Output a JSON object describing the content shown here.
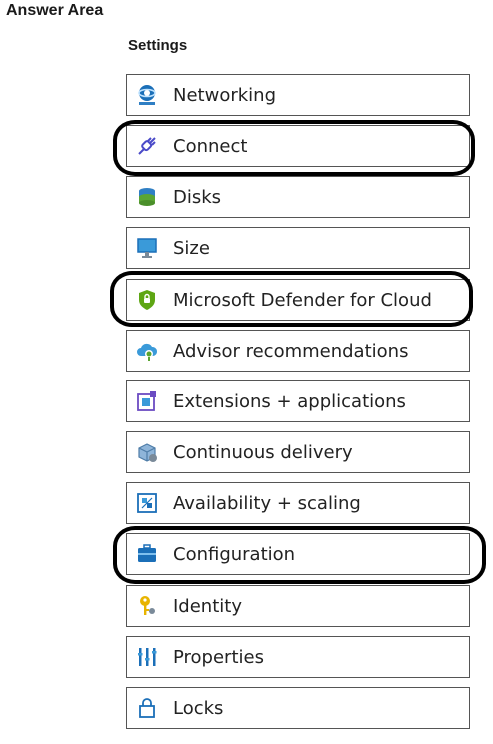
{
  "answer_area": {
    "title": "Answer Area"
  },
  "settings": {
    "title": "Settings",
    "items": [
      {
        "label": "Networking",
        "icon": "networking-icon",
        "selected": false
      },
      {
        "label": "Connect",
        "icon": "connect-icon",
        "selected": true
      },
      {
        "label": "Disks",
        "icon": "disks-icon",
        "selected": false
      },
      {
        "label": "Size",
        "icon": "size-icon",
        "selected": false
      },
      {
        "label": "Microsoft Defender for Cloud",
        "icon": "defender-shield-icon",
        "selected": true
      },
      {
        "label": "Advisor recommendations",
        "icon": "advisor-cloud-icon",
        "selected": false
      },
      {
        "label": "Extensions + applications",
        "icon": "extensions-icon",
        "selected": false
      },
      {
        "label": "Continuous delivery",
        "icon": "continuous-delivery-icon",
        "selected": false
      },
      {
        "label": "Availability + scaling",
        "icon": "availability-scaling-icon",
        "selected": false
      },
      {
        "label": "Configuration",
        "icon": "configuration-icon",
        "selected": true
      },
      {
        "label": "Identity",
        "icon": "identity-key-icon",
        "selected": false
      },
      {
        "label": "Properties",
        "icon": "properties-icon",
        "selected": false
      },
      {
        "label": "Locks",
        "icon": "lock-icon",
        "selected": false
      }
    ]
  },
  "colors": {
    "highlight_ring": "#000000",
    "item_border": "#555555",
    "azure_blue": "#0078d4",
    "defender_green": "#5ea614"
  }
}
